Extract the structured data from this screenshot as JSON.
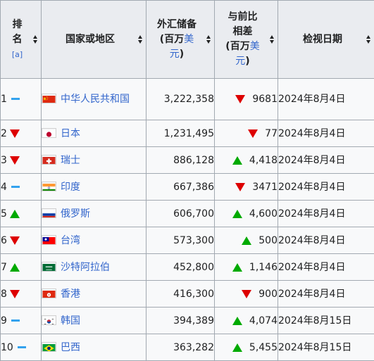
{
  "header": {
    "rank_line1": "排",
    "rank_line2": "名",
    "rank_note": "[a]",
    "country": "国家或地区",
    "reserves_line1": "外汇储备",
    "reserves_prefix": "(百万",
    "reserves_unit": "美",
    "reserves_unit2": "元",
    "reserves_suffix": ")",
    "diff_line1": "与前比",
    "diff_line2": "相差",
    "diff_prefix": "(百万",
    "diff_unit": "美",
    "diff_unit2": "元",
    "diff_suffix": ")",
    "date": "检视日期"
  },
  "rows": [
    {
      "rank": "1",
      "rank_trend": "same",
      "country": "中华人民共和国",
      "flag": "china-flag-icon",
      "reserves": "3,222,358",
      "delta_dir": "down",
      "delta": "9681",
      "date": "2024年8月4日"
    },
    {
      "rank": "2",
      "rank_trend": "down",
      "country": "日本",
      "flag": "japan-flag-icon",
      "reserves": "1,231,495",
      "delta_dir": "down",
      "delta": "77",
      "date": "2024年8月4日"
    },
    {
      "rank": "3",
      "rank_trend": "down",
      "country": "瑞士",
      "flag": "switzerland-flag-icon",
      "reserves": "886,128",
      "delta_dir": "up",
      "delta": "4,418",
      "date": "2024年8月4日"
    },
    {
      "rank": "4",
      "rank_trend": "same",
      "country": "印度",
      "flag": "india-flag-icon",
      "reserves": "667,386",
      "delta_dir": "down",
      "delta": "3471",
      "date": "2024年8月4日"
    },
    {
      "rank": "5",
      "rank_trend": "up",
      "country": "俄罗斯",
      "flag": "russia-flag-icon",
      "reserves": "606,700",
      "delta_dir": "up",
      "delta": "4,600",
      "date": "2024年8月4日"
    },
    {
      "rank": "6",
      "rank_trend": "down",
      "country": "台湾",
      "flag": "taiwan-flag-icon",
      "reserves": "573,300",
      "delta_dir": "up",
      "delta": "500",
      "date": "2024年8月4日"
    },
    {
      "rank": "7",
      "rank_trend": "up",
      "country": "沙特阿拉伯",
      "flag": "saudi-arabia-flag-icon",
      "reserves": "452,800",
      "delta_dir": "up",
      "delta": "1,146",
      "date": "2024年8月4日"
    },
    {
      "rank": "8",
      "rank_trend": "down",
      "country": "香港",
      "flag": "hong-kong-flag-icon",
      "reserves": "416,300",
      "delta_dir": "down",
      "delta": "900",
      "date": "2024年8月4日"
    },
    {
      "rank": "9",
      "rank_trend": "same",
      "country": "韩国",
      "flag": "south-korea-flag-icon",
      "reserves": "394,389",
      "delta_dir": "up",
      "delta": "4,074",
      "date": "2024年8月15日"
    },
    {
      "rank": "10",
      "rank_trend": "same",
      "country": "巴西",
      "flag": "brazil-flag-icon",
      "reserves": "363,282",
      "delta_dir": "up",
      "delta": "5,455",
      "date": "2024年8月15日"
    }
  ],
  "colors": {
    "up": "#00aa00",
    "down": "#dd0000",
    "same": "#33a2ee",
    "link": "#3366cc",
    "header_bg": "#eaecf0",
    "cell_bg": "#f8f9fa",
    "border": "#a2a9b1"
  }
}
